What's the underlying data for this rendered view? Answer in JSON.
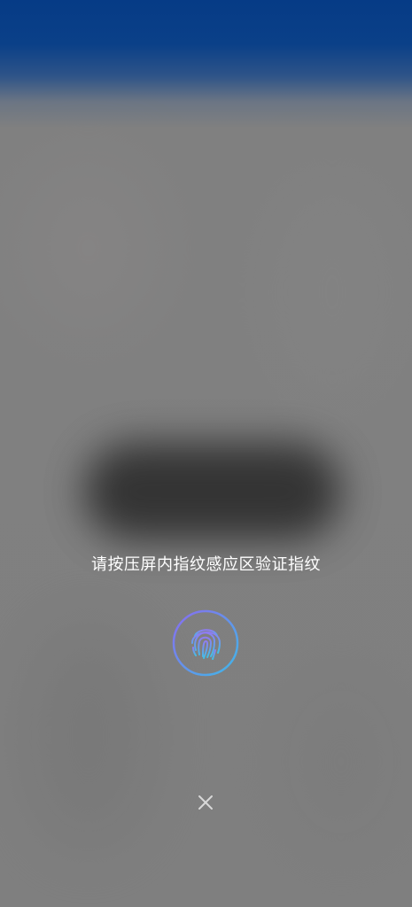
{
  "prompt": {
    "text": "请按压屏内指纹感应区验证指纹"
  },
  "fingerprint": {
    "icon": "fingerprint-icon",
    "ring_colors": [
      "#8a6cf0",
      "#3fb8e8"
    ]
  },
  "close": {
    "icon": "close-icon"
  },
  "colors": {
    "top_bar": "#063b86",
    "background": "#7f7f7f",
    "text": "#ffffff"
  }
}
